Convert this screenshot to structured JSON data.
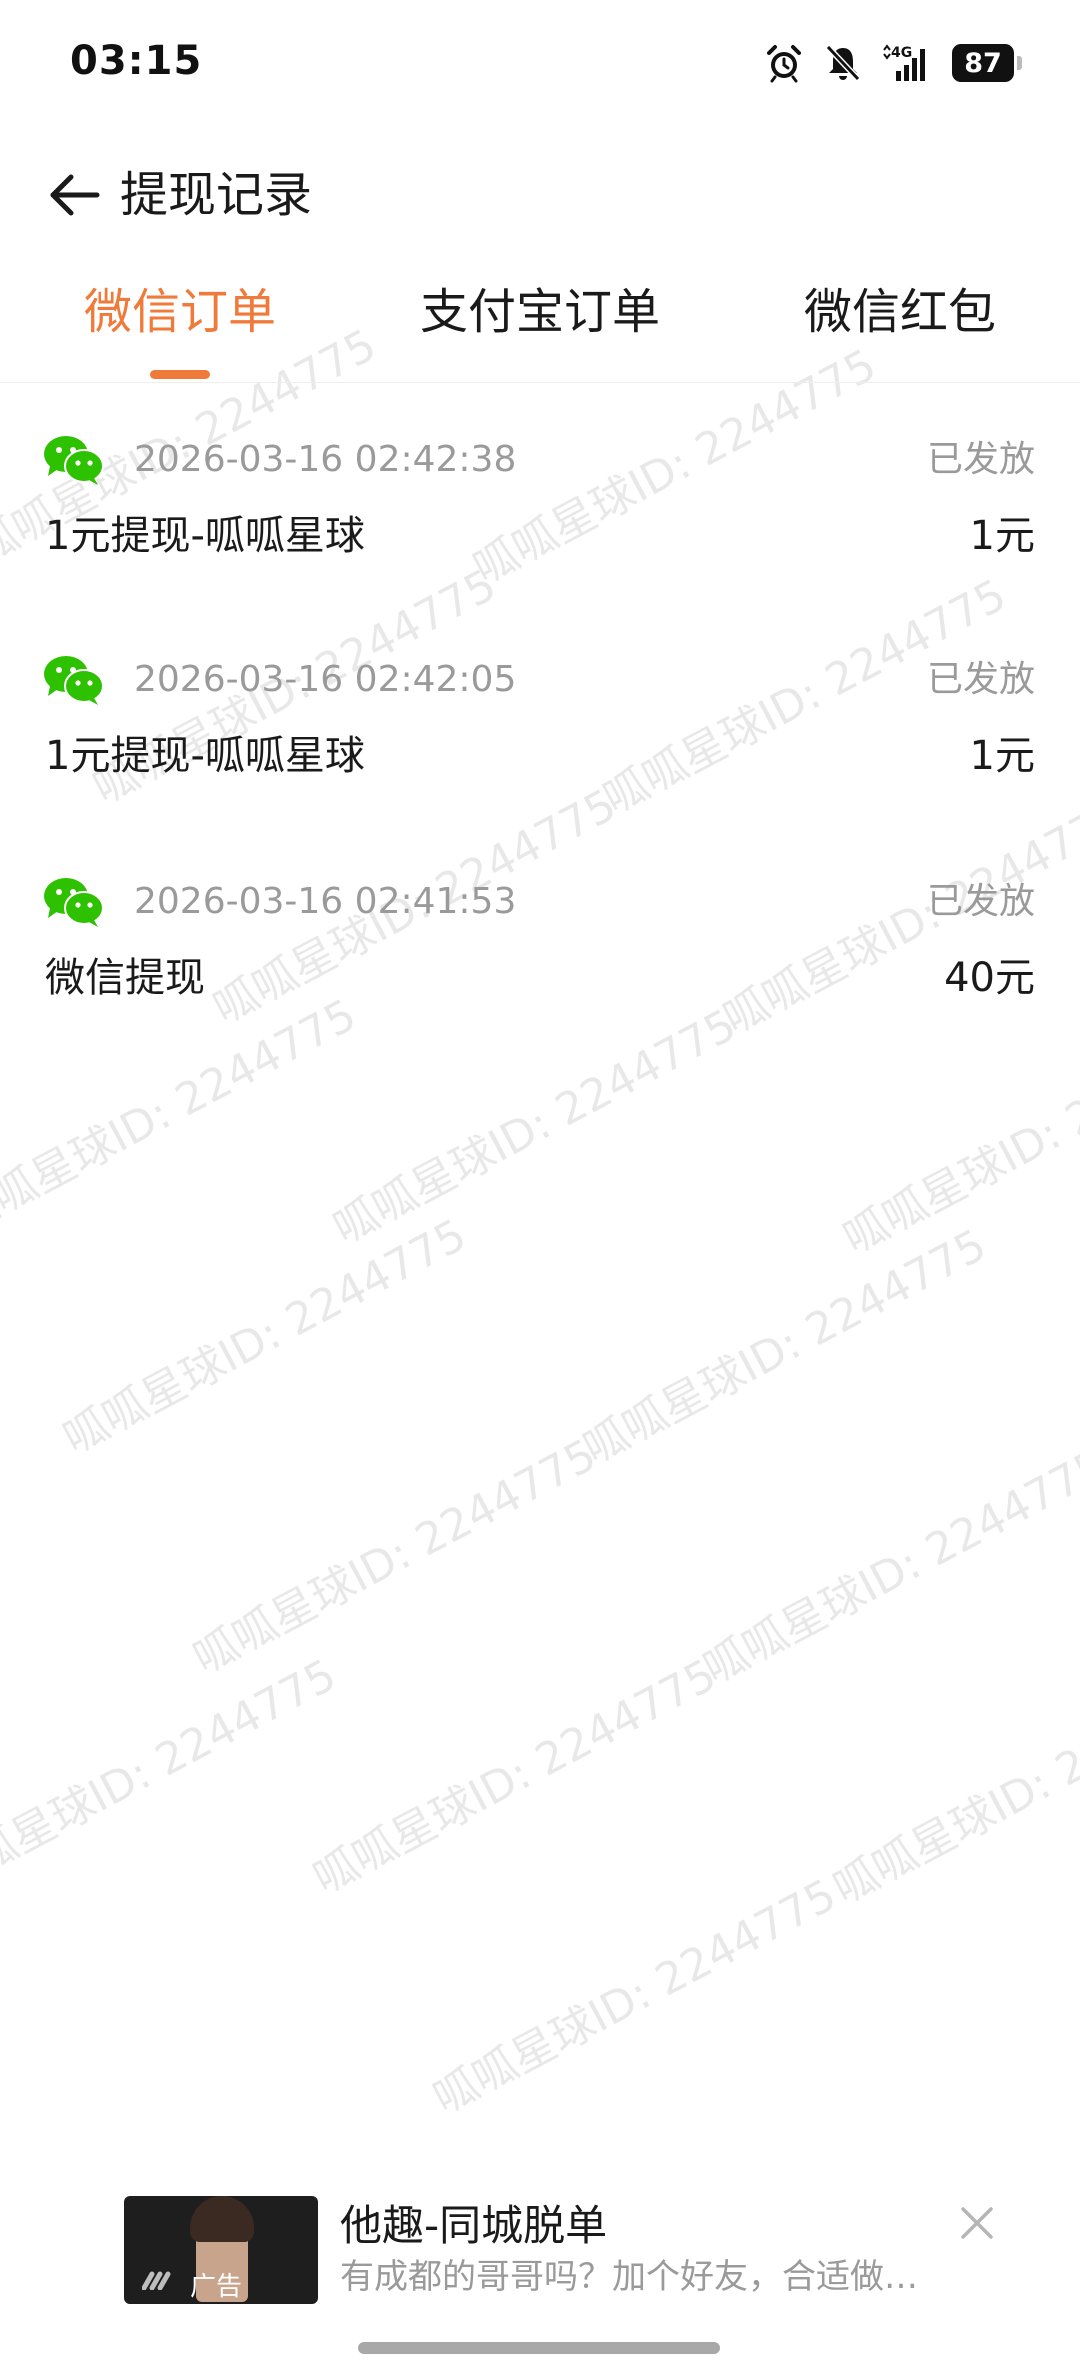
{
  "status_bar": {
    "time": "03:15",
    "network": "4G",
    "battery": "87",
    "icons": [
      "alarm-icon",
      "mute-icon",
      "signal-icon",
      "battery-icon"
    ]
  },
  "header": {
    "title": "提现记录",
    "back_icon": "arrow-left-icon"
  },
  "tabs": [
    {
      "label": "微信订单",
      "active": true
    },
    {
      "label": "支付宝订单",
      "active": false
    },
    {
      "label": "微信红包",
      "active": false
    }
  ],
  "records": [
    {
      "icon": "wechat-icon",
      "time": "2026-03-16 02:42:38",
      "status": "已发放",
      "title": "1元提现-呱呱星球",
      "amount": "1元"
    },
    {
      "icon": "wechat-icon",
      "time": "2026-03-16 02:42:05",
      "status": "已发放",
      "title": "1元提现-呱呱星球",
      "amount": "1元"
    },
    {
      "icon": "wechat-icon",
      "time": "2026-03-16 02:41:53",
      "status": "已发放",
      "title": "微信提现",
      "amount": "40元"
    }
  ],
  "watermark": "呱呱星球ID: 2244775",
  "ad": {
    "badge": "广告",
    "title": "他趣-同城脱单",
    "description": "有成都的哥哥吗？加个好友，合适做…",
    "close_icon": "close-icon"
  },
  "colors": {
    "accent": "#f07a3a",
    "wechat_green": "#2dc100",
    "secondary_text": "#9a9a9a"
  }
}
